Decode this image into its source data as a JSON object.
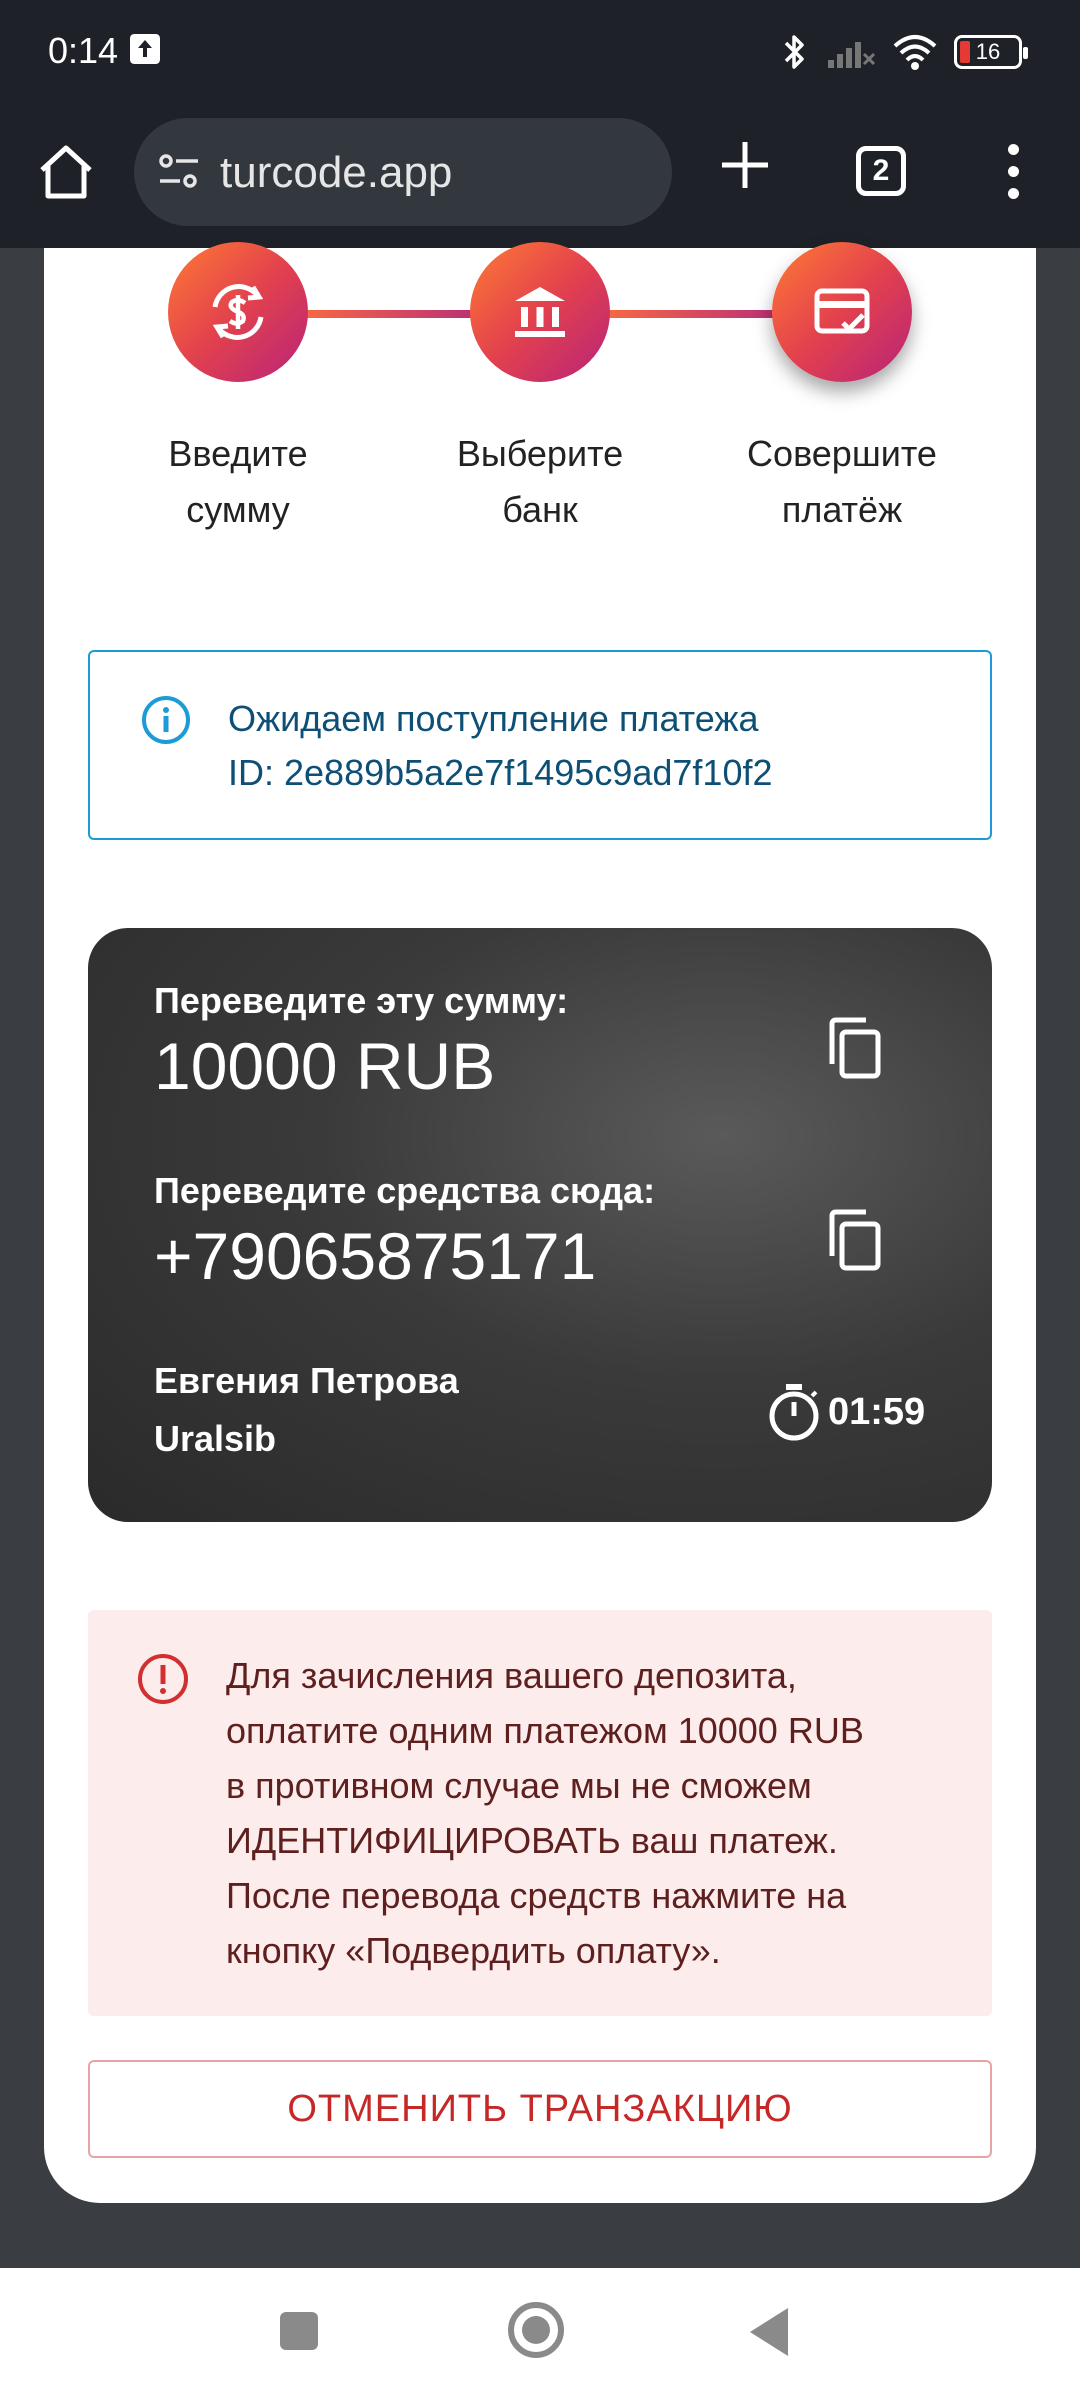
{
  "status_bar": {
    "time": "0:14",
    "battery": "16"
  },
  "browser": {
    "url": "turcode.app",
    "tab_count": "2"
  },
  "steps": [
    {
      "label_line1": "Введите",
      "label_line2": "сумму",
      "icon": "currency-exchange-icon"
    },
    {
      "label_line1": "Выберите",
      "label_line2": "банк",
      "icon": "bank-icon"
    },
    {
      "label_line1": "Совершите",
      "label_line2": "платёж",
      "icon": "card-check-icon"
    }
  ],
  "info": {
    "line1": "Ожидаем поступление платежа",
    "line2": "ID: 2e889b5a2e7f1495c9ad7f10f2"
  },
  "payment": {
    "amount_label": "Переведите эту сумму:",
    "amount_value": "10000 RUB",
    "recipient_label": "Переведите средства сюда:",
    "recipient_value": "+79065875171",
    "holder_name": "Евгения Петрова",
    "bank_name": "Uralsib",
    "timer": "01:59"
  },
  "warning": {
    "line1": "Для зачисления вашего депозита,",
    "line2": "оплатите одним платежом 10000 RUB",
    "line3": "в противном случае мы не сможем",
    "line4": "ИДЕНТИФИЦИРОВАТЬ ваш платеж.",
    "line5": "После перевода средств нажмите на",
    "line6": "кнопку «Подвердить оплату»."
  },
  "actions": {
    "cancel_label": "ОТМЕНИТЬ ТРАНЗАКЦИЮ"
  },
  "colors": {
    "accent_start": "#ff7a35",
    "accent_end": "#b8237a",
    "info_border": "#1c9bd6",
    "warning_bg": "#fdecec",
    "cancel_text": "#c62828"
  }
}
